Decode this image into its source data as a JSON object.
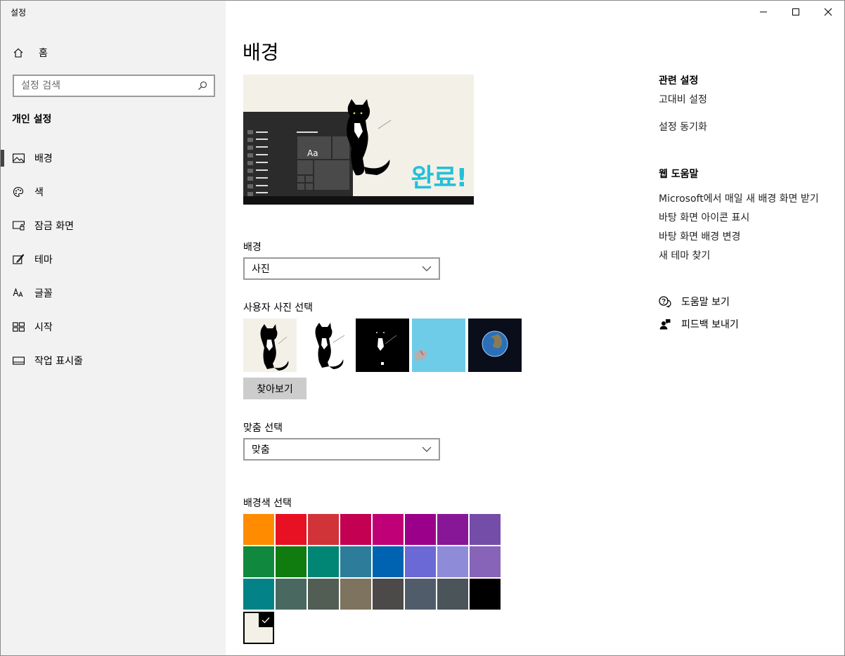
{
  "window": {
    "title": "설정",
    "controls": {
      "minimize_icon": "minimize-icon",
      "maximize_icon": "maximize-icon",
      "close_icon": "close-icon"
    }
  },
  "sidebar": {
    "home_label": "홈",
    "search_placeholder": "설정 검색",
    "section_title": "개인 설정",
    "items": [
      {
        "label": "배경",
        "icon": "picture-icon",
        "active": true
      },
      {
        "label": "색",
        "icon": "palette-icon",
        "active": false
      },
      {
        "label": "잠금 화면",
        "icon": "lock-screen-icon",
        "active": false
      },
      {
        "label": "테마",
        "icon": "theme-brush-icon",
        "active": false
      },
      {
        "label": "글꼴",
        "icon": "font-icon",
        "active": false
      },
      {
        "label": "시작",
        "icon": "start-tiles-icon",
        "active": false
      },
      {
        "label": "작업 표시줄",
        "icon": "taskbar-icon",
        "active": false
      }
    ]
  },
  "main": {
    "title": "배경",
    "preview": {
      "tile_text": "Aa",
      "wallpaper_text": "완료!"
    },
    "background": {
      "label": "배경",
      "value": "사진"
    },
    "photos": {
      "label": "사용자 사진 선택",
      "browse_label": "찾아보기"
    },
    "fit": {
      "label": "맞춤 선택",
      "value": "맞춤"
    },
    "colors": {
      "label": "배경색 선택",
      "rows": [
        [
          "#ff8c00",
          "#e81123",
          "#d13438",
          "#c30052",
          "#bf0077",
          "#9a0089",
          "#881798",
          "#744da9"
        ],
        [
          "#10893e",
          "#107c10",
          "#018574",
          "#2d7d9a",
          "#0063b1",
          "#6b69d6",
          "#8e8cd8",
          "#8764b8"
        ],
        [
          "#038387",
          "#486860",
          "#525e54",
          "#7e735f",
          "#4c4a48",
          "#515c6b",
          "#4a5459",
          "#000000"
        ]
      ],
      "custom_color": "#f3f0e7"
    }
  },
  "related": {
    "heading": "관련 설정",
    "links": [
      "고대비 설정",
      "설정 동기화"
    ]
  },
  "web_help": {
    "heading": "웹 도움말",
    "links": [
      "Microsoft에서 매일 새 배경 화면 받기",
      "바탕 화면 아이콘 표시",
      "바탕 화면 배경 변경",
      "새 테마 찾기"
    ]
  },
  "support": {
    "get_help": "도움말 보기",
    "feedback": "피드백 보내기"
  }
}
